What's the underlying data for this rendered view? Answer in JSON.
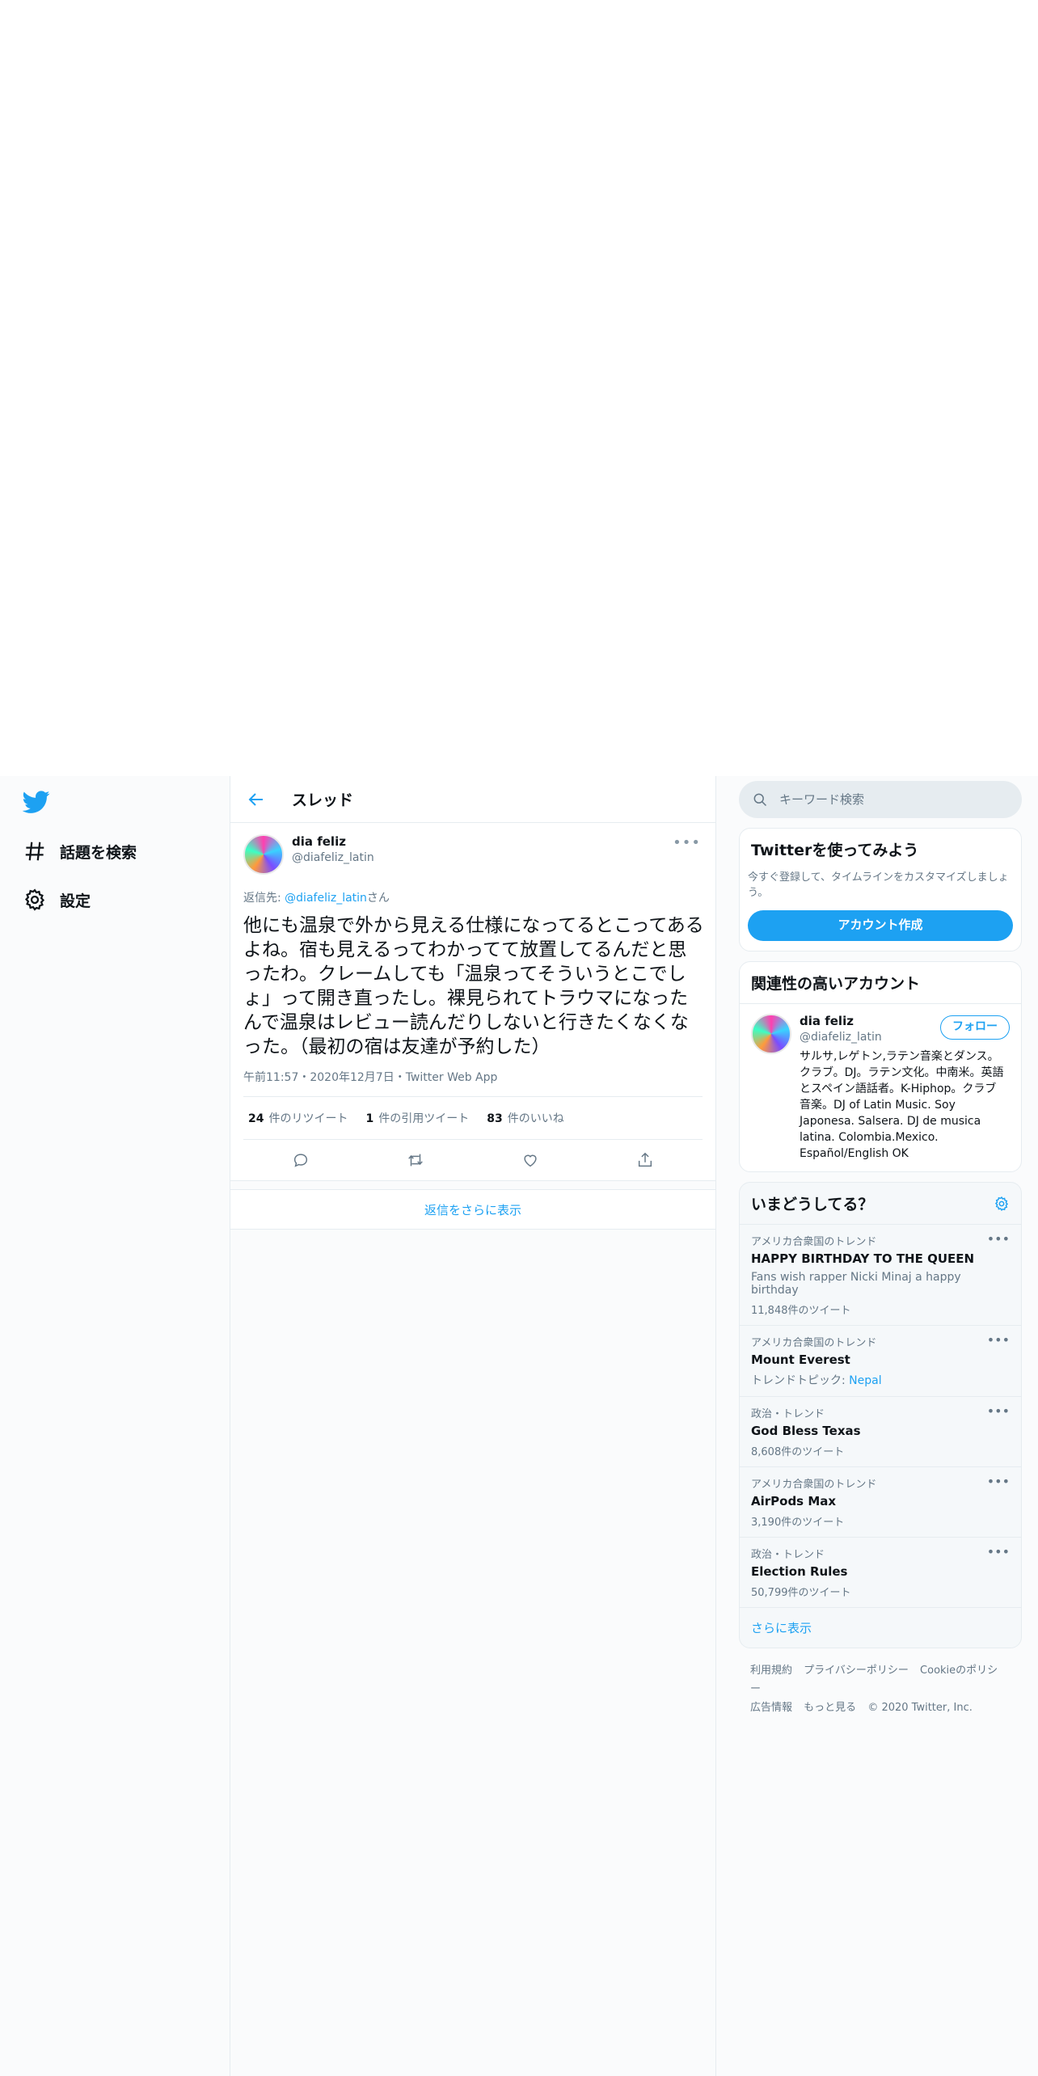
{
  "nav": {
    "items": [
      {
        "label": "話題を検索",
        "icon": "hashtag-icon"
      },
      {
        "label": "設定",
        "icon": "gear-icon"
      }
    ]
  },
  "header": {
    "title": "スレッド"
  },
  "tweet": {
    "name": "dia feliz",
    "handle": "@diafeliz_latin",
    "reply_prefix": "返信先: ",
    "reply_handle": "@diafeliz_latin",
    "reply_suffix": "さん",
    "text": "他にも温泉で外から見える仕様になってるとこってあるよね。宿も見えるってわかってて放置してるんだと思ったわ。クレームしても「温泉ってそういうとこでしょ」って開き直ったし。裸見られてトラウマになったんで温泉はレビュー読んだりしないと行きたくなくなった。（最初の宿は友達が予約した）",
    "meta": "午前11:57・2020年12月7日・Twitter Web App",
    "retweets": {
      "count": "24",
      "label": "件のリツイート"
    },
    "quotes": {
      "count": "1",
      "label": "件の引用ツイート"
    },
    "likes": {
      "count": "83",
      "label": "件のいいね"
    }
  },
  "more_replies": "返信をさらに表示",
  "search": {
    "placeholder": "キーワード検索"
  },
  "join": {
    "title": "Twitterを使ってみよう",
    "desc": "今すぐ登録して、タイムラインをカスタマイズしましょう。",
    "button": "アカウント作成"
  },
  "related": {
    "title": "関連性の高いアカウント",
    "name": "dia feliz",
    "handle": "@diafeliz_latin",
    "follow": "フォロー",
    "bio": "サルサ,レゲトン,ラテン音楽とダンス。クラブ。DJ。ラテン文化。中南米。英語とスペイン語話者。K-Hiphop。クラブ音楽。DJ of Latin Music. Soy Japonesa. Salsera. DJ de musica latina. Colombia.Mexico. Español/English OK"
  },
  "trends": {
    "title": "いまどうしてる？",
    "items": [
      {
        "cat": "アメリカ合衆国のトレンド",
        "name": "HAPPY BIRTHDAY TO THE QUEEN",
        "desc": "Fans wish rapper Nicki Minaj a happy birthday",
        "count": "11,848件のツイート"
      },
      {
        "cat": "アメリカ合衆国のトレンド",
        "name": "Mount Everest",
        "desc_prefix": "トレンドトピック: ",
        "desc_link": "Nepal"
      },
      {
        "cat": "政治・トレンド",
        "name": "God Bless Texas",
        "count": "8,608件のツイート"
      },
      {
        "cat": "アメリカ合衆国のトレンド",
        "name": "AirPods Max",
        "count": "3,190件のツイート"
      },
      {
        "cat": "政治・トレンド",
        "name": "Election Rules",
        "count": "50,799件のツイート"
      }
    ],
    "show_more": "さらに表示"
  },
  "footer": {
    "terms": "利用規約",
    "privacy": "プライバシーポリシー",
    "cookie": "Cookieのポリシー",
    "ads": "広告情報",
    "more": "もっと見る",
    "copyright": "© 2020 Twitter, Inc."
  },
  "colors": {
    "accent": "#1da1f2",
    "text": "#0f1419",
    "muted": "#657786",
    "border": "#e6ecf0"
  }
}
